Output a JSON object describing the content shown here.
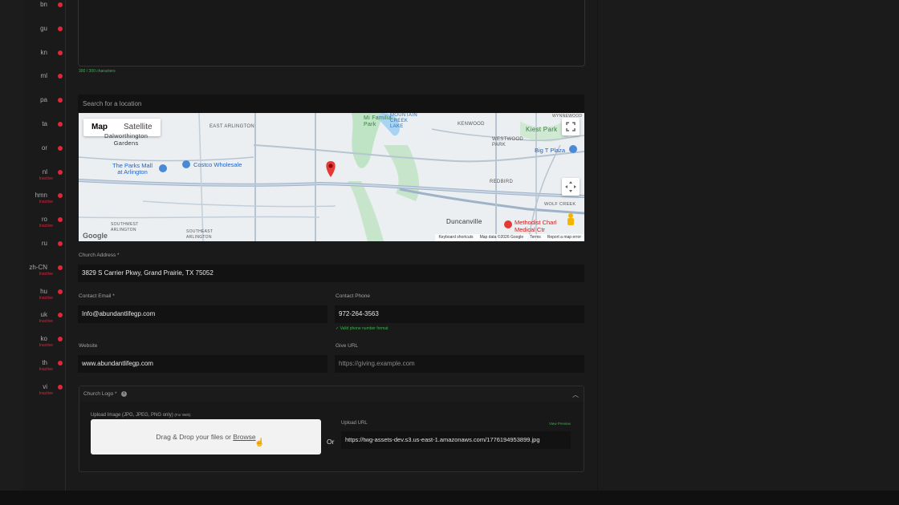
{
  "languages": [
    {
      "code": "bn",
      "status": ""
    },
    {
      "code": "gu",
      "status": ""
    },
    {
      "code": "kn",
      "status": ""
    },
    {
      "code": "ml",
      "status": ""
    },
    {
      "code": "pa",
      "status": ""
    },
    {
      "code": "ta",
      "status": ""
    },
    {
      "code": "or",
      "status": ""
    },
    {
      "code": "nl",
      "status": "Inactive"
    },
    {
      "code": "hmn",
      "status": "Inactive"
    },
    {
      "code": "ro",
      "status": "Inactive"
    },
    {
      "code": "ru",
      "status": ""
    },
    {
      "code": "zh-CN",
      "status": "Inactive"
    },
    {
      "code": "hu",
      "status": "Inactive"
    },
    {
      "code": "uk",
      "status": "Inactive"
    },
    {
      "code": "ko",
      "status": "Inactive"
    },
    {
      "code": "th",
      "status": "Inactive"
    },
    {
      "code": "vi",
      "status": "Inactive"
    }
  ],
  "description": {
    "char_count": "300 / 300 characters"
  },
  "location": {
    "placeholder": "Search for a location"
  },
  "map": {
    "map_tab": "Map",
    "satellite_tab": "Satellite",
    "labels": {
      "east_arlington": "EAST ARLINGTON",
      "mi_familia_park": "Mi Familia\nPark",
      "mountain_creek_lake": "MOUNTAIN\nCREEK\nLAKE",
      "kenwood": "KENWOOD",
      "kiest_park": "Kiest Park",
      "dalworthington": "Dalworthington\nGardens",
      "parks_mall": "The Parks Mall\nat Arlington",
      "costco": "Costco Wholesale",
      "westwood_park": "WESTWOOD\nPARK",
      "big_t_plaza": "Big T Plaza",
      "redbird": "REDBIRD",
      "wolf_creek": "WOLF CREEK",
      "duncanville": "Duncanville",
      "methodist": "Methodist Charl\nMedical Ctr",
      "southwest_arlington": "SOUTHWEST\nARLINGTON",
      "southeast_arlington": "SOUTHEAST\nARLINGTON",
      "wynnewood": "WYNNEWOOD"
    },
    "google": "Google",
    "footer": [
      "Keyboard shortcuts",
      "Map data ©2026 Google",
      "Terms",
      "Report a map error"
    ]
  },
  "address": {
    "label": "Church Address *",
    "value": "3829 S Carrier Pkwy, Grand Prairie, TX 75052"
  },
  "contact_email": {
    "label": "Contact Email *",
    "value": "Info@abundantlifegp.com"
  },
  "contact_phone": {
    "label": "Contact Phone",
    "value": "972-264-3563",
    "valid": "✓ Valid phone number format"
  },
  "website": {
    "label": "Website",
    "value": "www.abundantlifegp.com"
  },
  "give_url": {
    "label": "Give URL",
    "placeholder": "https://giving.example.com"
  },
  "logo": {
    "title": "Church Logo *",
    "upload_label": "Upload Image (JPG, JPEG, PNG only)",
    "upload_hint": "(For Web)",
    "drop_text": "Drag & Drop your files or ",
    "browse": "Browse",
    "or": "Or",
    "url_label": "Upload URL",
    "view_preview": "View Preview",
    "url_value": "https://twg-assets-dev.s3.us-east-1.amazonaws.com/1776194953899.jpg"
  }
}
